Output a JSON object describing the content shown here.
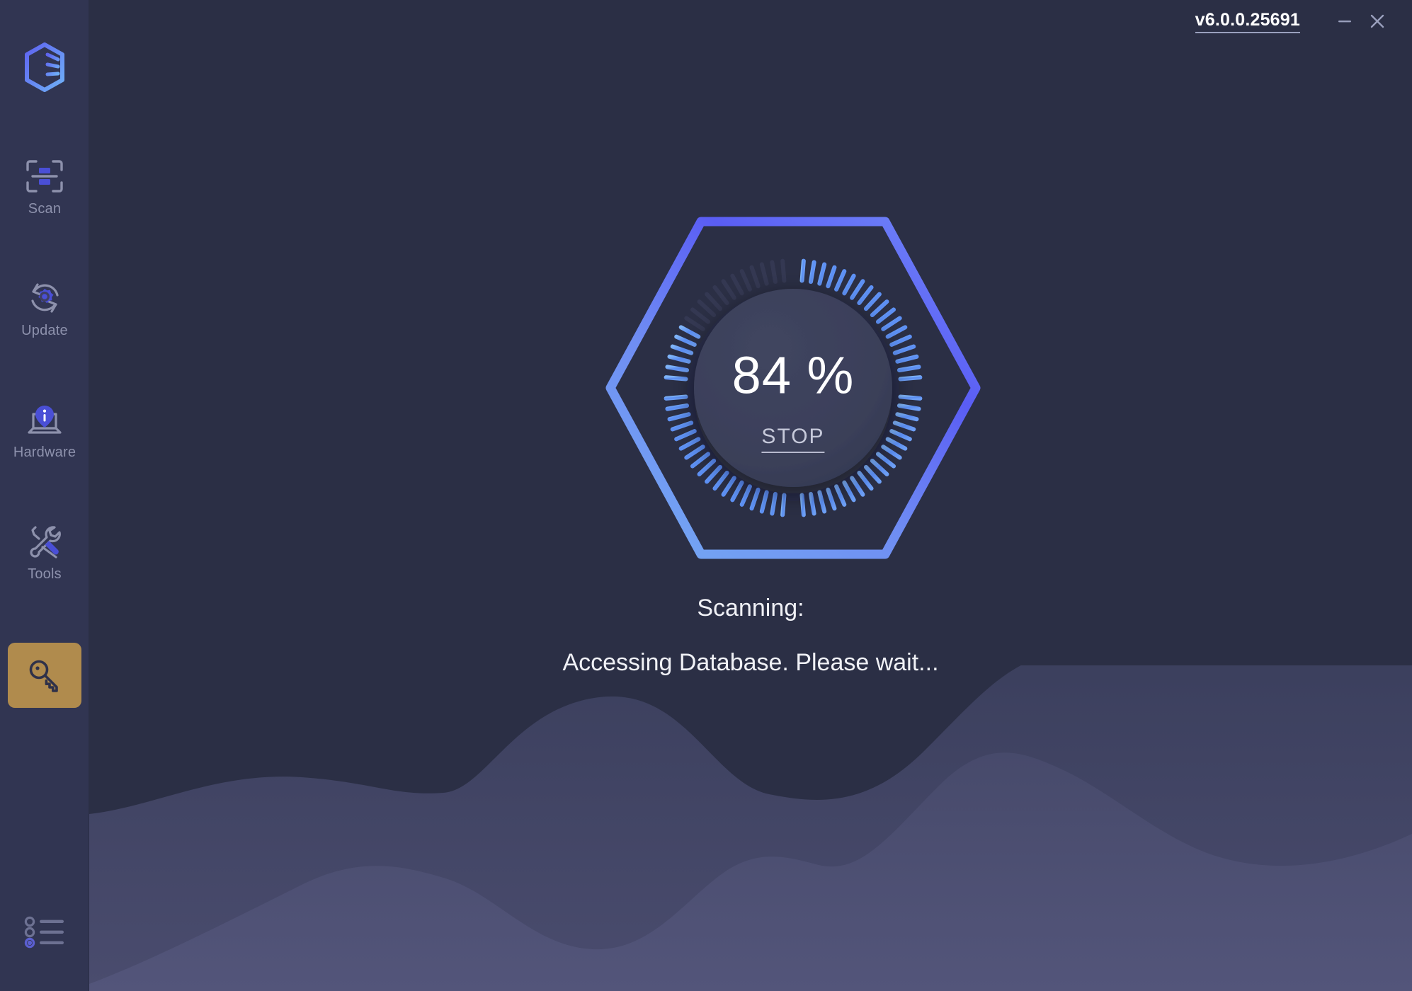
{
  "window": {
    "version": "v6.0.0.25691",
    "minimize_label": "—",
    "close_label": "✕"
  },
  "sidebar": {
    "logo_name": "driver-booster-hexagon-logo",
    "items": [
      {
        "label": "Scan",
        "icon": "scan-icon",
        "active": false
      },
      {
        "label": "Update",
        "icon": "update-icon",
        "active": false
      },
      {
        "label": "Hardware",
        "icon": "hardware-icon",
        "active": false
      },
      {
        "label": "Tools",
        "icon": "tools-icon",
        "active": false
      }
    ],
    "license_button": {
      "icon": "key-icon",
      "label": ""
    },
    "bottom_menu": {
      "icon": "list-menu-icon",
      "label": ""
    }
  },
  "scan": {
    "percent_text": "84 %",
    "percent_value": 84,
    "stop_label": "STOP",
    "status_title": "Scanning:",
    "status_detail": "Accessing Database. Please wait..."
  },
  "colors": {
    "background": "#2b2f45",
    "sidebar": "#313552",
    "accent_indigo": "#5b5ef5",
    "accent_blue": "#6fa5f5",
    "license_gold": "#b08b4d",
    "inner_disc": "#3a3f5c",
    "tick_off": "#343852",
    "text_primary": "#f0f1f6",
    "text_muted": "#8d91ac"
  }
}
